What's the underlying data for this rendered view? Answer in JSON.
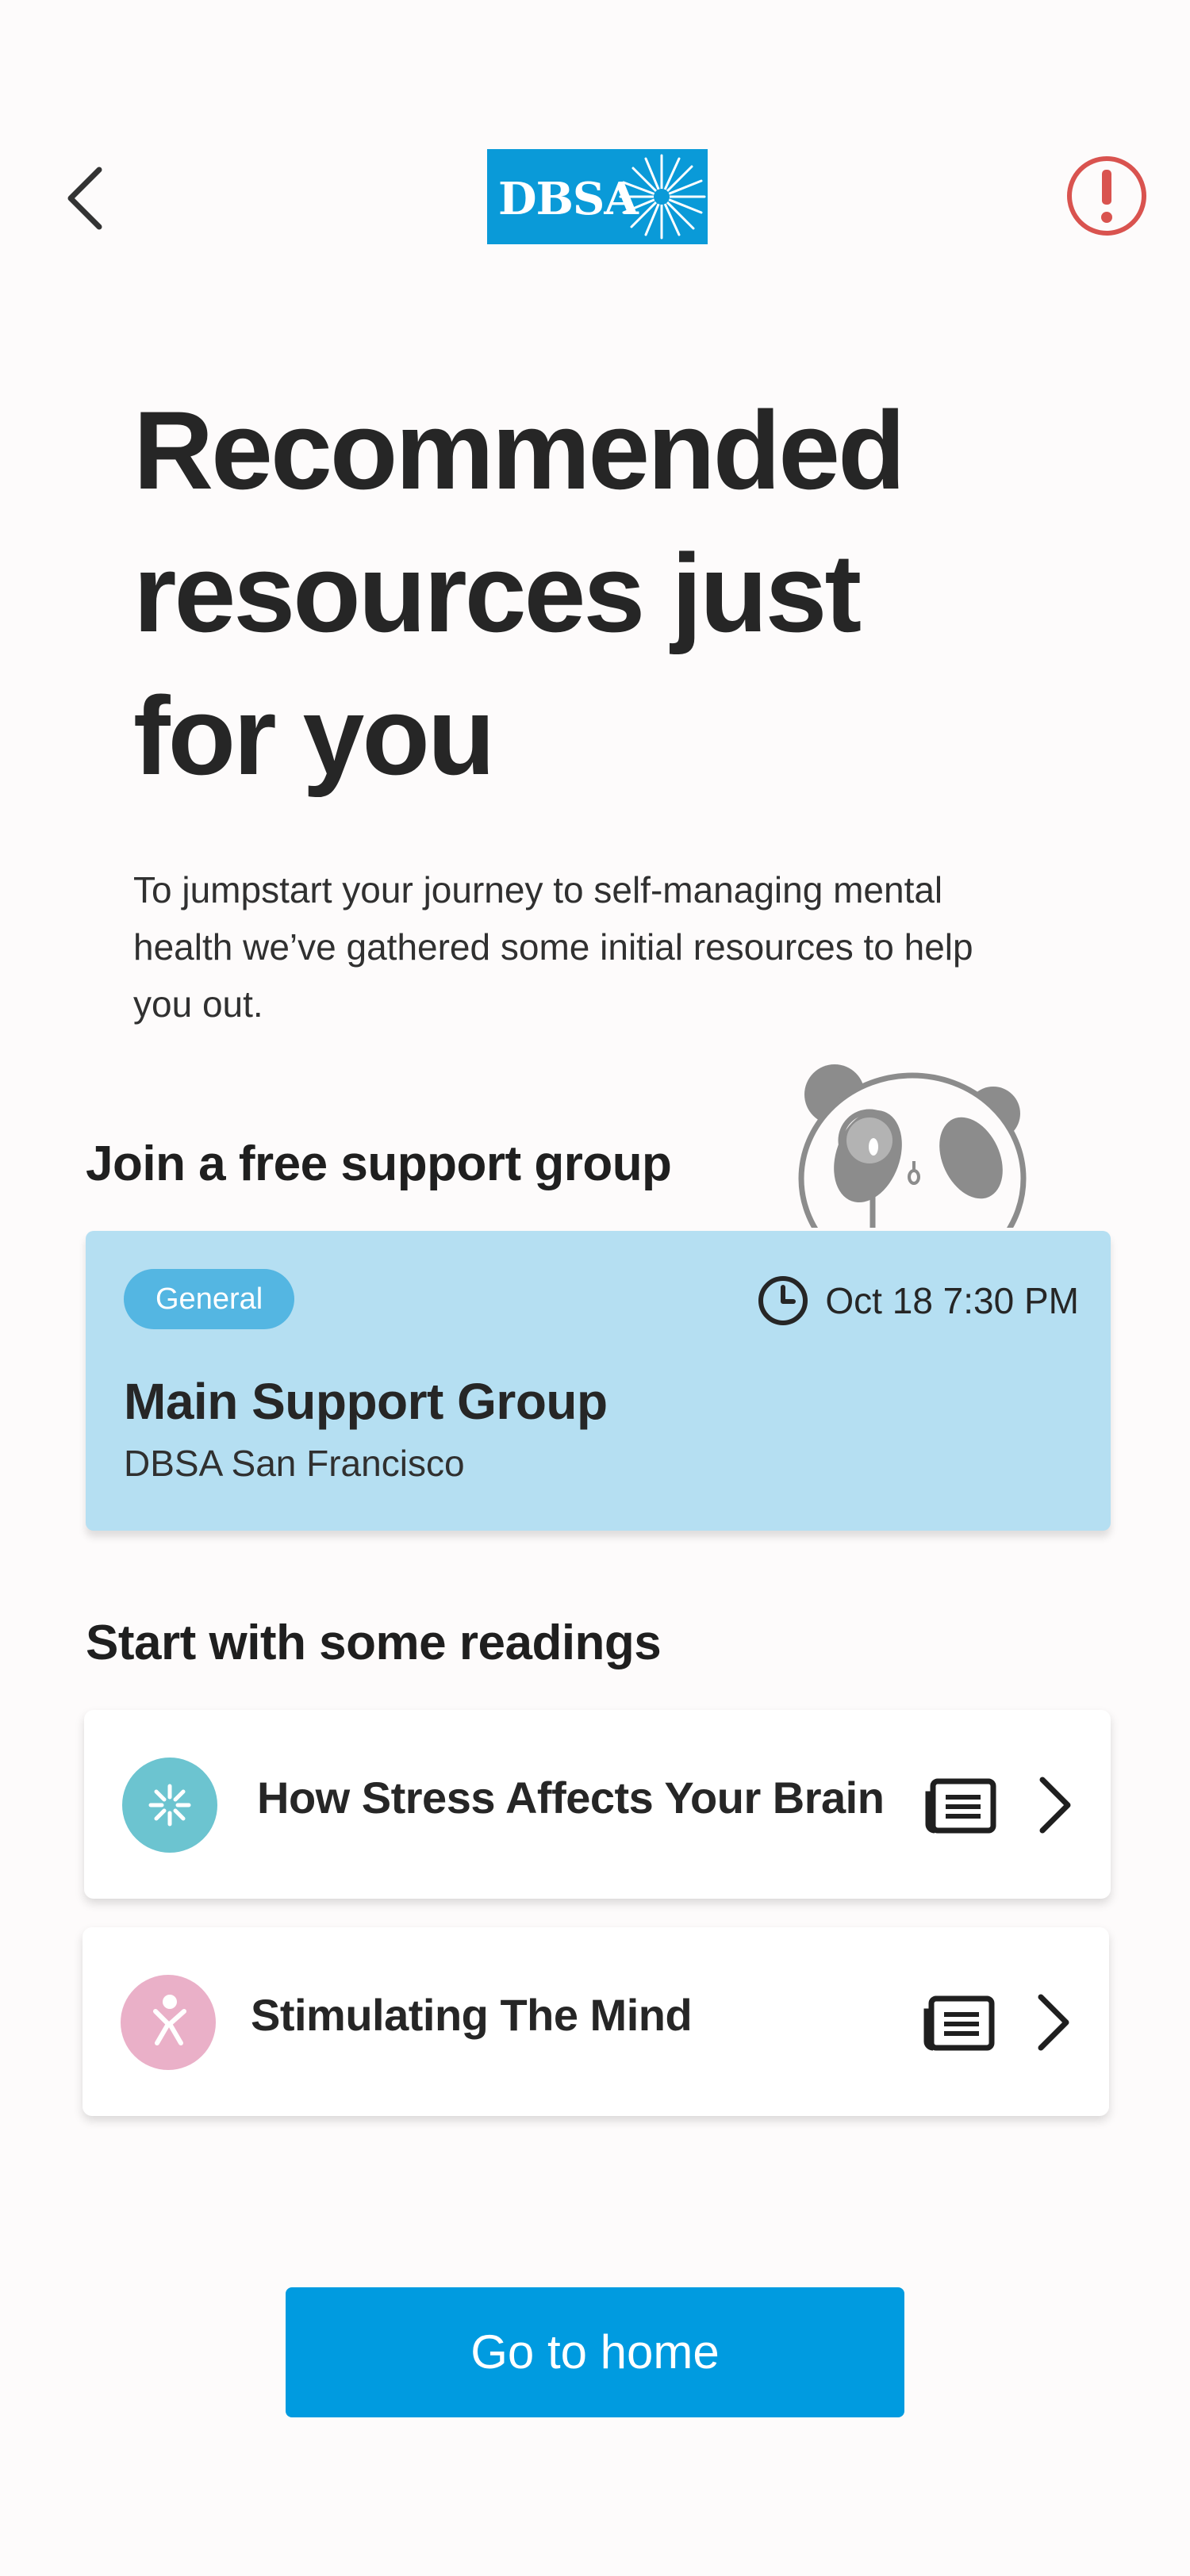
{
  "header": {
    "back_icon": "chevron-left-icon",
    "logo_text": "DBSA",
    "alert_icon": "exclamation-circle-icon",
    "logo_color": "#0a9ad8",
    "alert_color": "#d9534f"
  },
  "hero": {
    "title_line1": "Recommended",
    "title_line2": "resources just",
    "title_line3": "for you",
    "subtitle_line1": "To jumpstart your journey to self-managing mental",
    "subtitle_line2": "health we’ve gathered some initial resources to help",
    "subtitle_line3": "you out."
  },
  "support_section": {
    "heading": "Join a free support group",
    "mascot_icon": "panda-mascot-icon",
    "card": {
      "tag": "General",
      "time": "Oct 18 7:30 PM",
      "title": "Main Support Group",
      "organization": "DBSA San Francisco",
      "background": "#b5dff2"
    }
  },
  "readings_section": {
    "heading": "Start with some readings",
    "items": [
      {
        "title": "How Stress Affects Your Brain",
        "icon": "sparkle-icon",
        "icon_color": "#6cc4d0"
      },
      {
        "title": "Stimulating The Mind",
        "icon": "person-jumping-icon",
        "icon_color": "#eab0c8"
      }
    ]
  },
  "cta": {
    "label": "Go to home",
    "color": "#009be0"
  }
}
